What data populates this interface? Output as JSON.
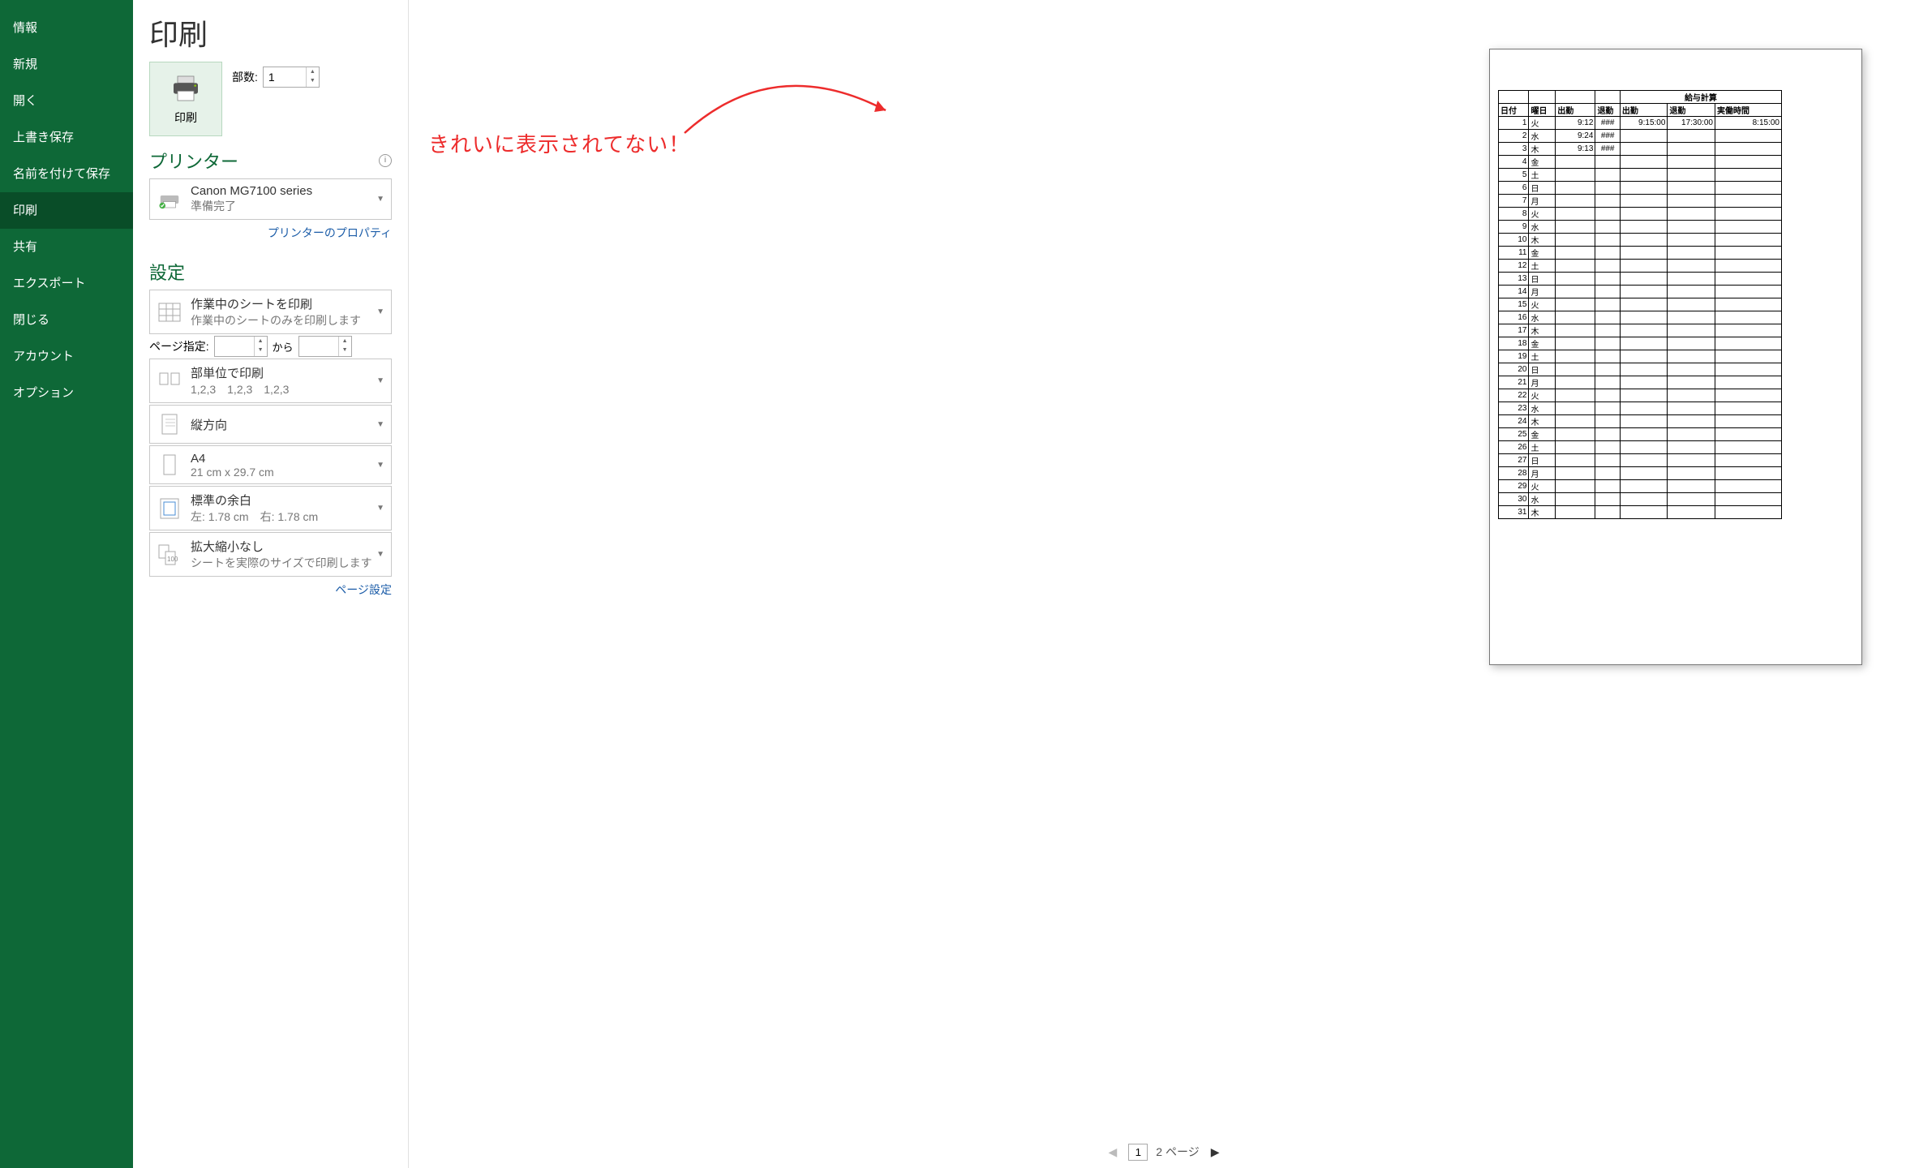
{
  "sidebar": {
    "items": [
      {
        "label": "情報"
      },
      {
        "label": "新規"
      },
      {
        "label": "開く"
      },
      {
        "label": "上書き保存"
      },
      {
        "label": "名前を付けて保存"
      },
      {
        "label": "印刷",
        "selected": true
      },
      {
        "label": "共有"
      },
      {
        "label": "エクスポート"
      },
      {
        "label": "閉じる"
      },
      {
        "label": "アカウント"
      },
      {
        "label": "オプション"
      }
    ]
  },
  "page": {
    "title": "印刷"
  },
  "print_button": {
    "label": "印刷"
  },
  "copies": {
    "label": "部数:",
    "value": "1"
  },
  "printer_section": {
    "title": "プリンター"
  },
  "printer": {
    "name": "Canon MG7100 series",
    "status": "準備完了"
  },
  "printer_props_link": "プリンターのプロパティ",
  "settings_section": {
    "title": "設定"
  },
  "settings": [
    {
      "title": "作業中のシートを印刷",
      "sub": "作業中のシートのみを印刷します"
    },
    {
      "title": "部単位で印刷",
      "sub": "1,2,3　1,2,3　1,2,3"
    },
    {
      "title": "縦方向",
      "sub": ""
    },
    {
      "title": "A4",
      "sub": "21 cm x 29.7 cm"
    },
    {
      "title": "標準の余白",
      "sub": "左: 1.78 cm　右: 1.78 cm"
    },
    {
      "title": "拡大縮小なし",
      "sub": "シートを実際のサイズで印刷します"
    }
  ],
  "page_range": {
    "label": "ページ指定:",
    "from": "",
    "to": "",
    "kara": "から"
  },
  "page_setup_link": "ページ設定",
  "annotation": "きれいに表示されてない！",
  "preview_nav": {
    "page": "1",
    "total": "2 ページ"
  },
  "table": {
    "title": "給与計算",
    "headers": [
      "日付",
      "曜日",
      "出勤",
      "退勤",
      "出勤",
      "退勤",
      "実働時間"
    ],
    "rows": [
      {
        "d": "1",
        "w": "火",
        "in1": "9:12",
        "out1": "###",
        "in2": "9:15:00",
        "out2": "17:30:00",
        "time": "8:15:00"
      },
      {
        "d": "2",
        "w": "水",
        "in1": "9:24",
        "out1": "###",
        "in2": "",
        "out2": "",
        "time": ""
      },
      {
        "d": "3",
        "w": "木",
        "in1": "9:13",
        "out1": "###",
        "in2": "",
        "out2": "",
        "time": ""
      },
      {
        "d": "4",
        "w": "金"
      },
      {
        "d": "5",
        "w": "土"
      },
      {
        "d": "6",
        "w": "日"
      },
      {
        "d": "7",
        "w": "月"
      },
      {
        "d": "8",
        "w": "火"
      },
      {
        "d": "9",
        "w": "水"
      },
      {
        "d": "10",
        "w": "木"
      },
      {
        "d": "11",
        "w": "金"
      },
      {
        "d": "12",
        "w": "土"
      },
      {
        "d": "13",
        "w": "日"
      },
      {
        "d": "14",
        "w": "月"
      },
      {
        "d": "15",
        "w": "火"
      },
      {
        "d": "16",
        "w": "水"
      },
      {
        "d": "17",
        "w": "木"
      },
      {
        "d": "18",
        "w": "金"
      },
      {
        "d": "19",
        "w": "土"
      },
      {
        "d": "20",
        "w": "日"
      },
      {
        "d": "21",
        "w": "月"
      },
      {
        "d": "22",
        "w": "火"
      },
      {
        "d": "23",
        "w": "水"
      },
      {
        "d": "24",
        "w": "木"
      },
      {
        "d": "25",
        "w": "金"
      },
      {
        "d": "26",
        "w": "土"
      },
      {
        "d": "27",
        "w": "日"
      },
      {
        "d": "28",
        "w": "月"
      },
      {
        "d": "29",
        "w": "火"
      },
      {
        "d": "30",
        "w": "水"
      },
      {
        "d": "31",
        "w": "木"
      }
    ]
  }
}
